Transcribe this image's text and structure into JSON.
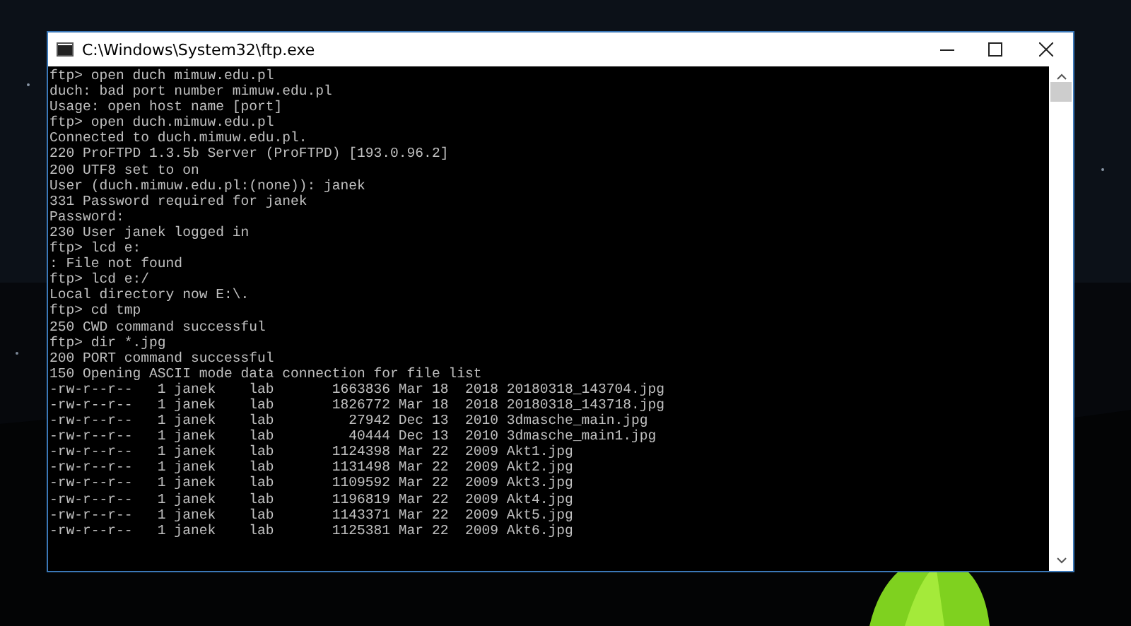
{
  "window": {
    "title": "C:\\Windows\\System32\\ftp.exe"
  },
  "console": {
    "lines": [
      "ftp> open duch mimuw.edu.pl",
      "duch: bad port number mimuw.edu.pl",
      "Usage: open host name [port]",
      "ftp> open duch.mimuw.edu.pl",
      "Connected to duch.mimuw.edu.pl.",
      "220 ProFTPD 1.3.5b Server (ProFTPD) [193.0.96.2]",
      "200 UTF8 set to on",
      "User (duch.mimuw.edu.pl:(none)): janek",
      "331 Password required for janek",
      "Password:",
      "230 User janek logged in",
      "ftp> lcd e:",
      ": File not found",
      "ftp> lcd e:/",
      "Local directory now E:\\.",
      "ftp> cd tmp",
      "250 CWD command successful",
      "ftp> dir *.jpg",
      "200 PORT command successful",
      "150 Opening ASCII mode data connection for file list",
      "-rw-r--r--   1 janek    lab       1663836 Mar 18  2018 20180318_143704.jpg",
      "-rw-r--r--   1 janek    lab       1826772 Mar 18  2018 20180318_143718.jpg",
      "-rw-r--r--   1 janek    lab         27942 Dec 13  2010 3dmasche_main.jpg",
      "-rw-r--r--   1 janek    lab         40444 Dec 13  2010 3dmasche_main1.jpg",
      "-rw-r--r--   1 janek    lab       1124398 Mar 22  2009 Akt1.jpg",
      "-rw-r--r--   1 janek    lab       1131498 Mar 22  2009 Akt2.jpg",
      "-rw-r--r--   1 janek    lab       1109592 Mar 22  2009 Akt3.jpg",
      "-rw-r--r--   1 janek    lab       1196819 Mar 22  2009 Akt4.jpg",
      "-rw-r--r--   1 janek    lab       1143371 Mar 22  2009 Akt5.jpg",
      "-rw-r--r--   1 janek    lab       1125381 Mar 22  2009 Akt6.jpg"
    ]
  }
}
